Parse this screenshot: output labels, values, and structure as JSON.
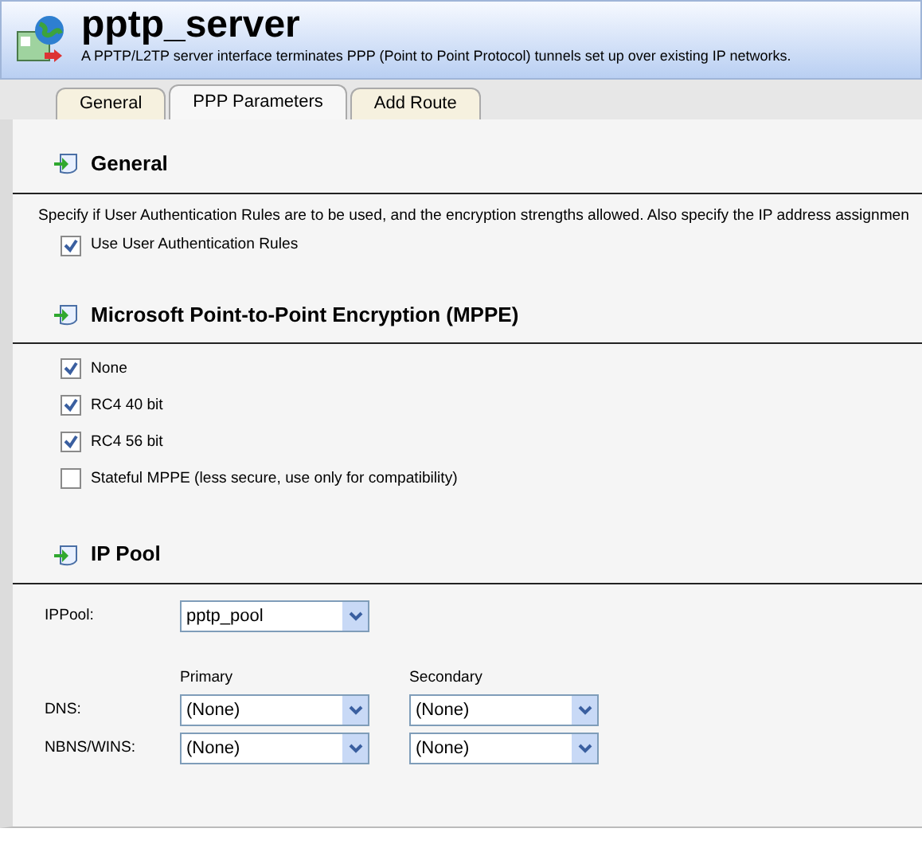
{
  "header": {
    "title": "pptp_server",
    "description": "A PPTP/L2TP server interface terminates PPP (Point to Point Protocol) tunnels set up over existing IP networks."
  },
  "tabs": [
    {
      "label": "General",
      "selected": false
    },
    {
      "label": "PPP Parameters",
      "selected": true
    },
    {
      "label": "Add Route",
      "selected": false
    }
  ],
  "general": {
    "heading": "General",
    "description": "Specify if User Authentication Rules are to be used, and the encryption strengths allowed. Also specify the IP address assignmen",
    "checkboxes": [
      {
        "label": "Use User Authentication Rules",
        "checked": true
      }
    ]
  },
  "mppe": {
    "heading": "Microsoft Point-to-Point Encryption (MPPE)",
    "checkboxes": [
      {
        "label": "None",
        "checked": true
      },
      {
        "label": "RC4 40 bit",
        "checked": true
      },
      {
        "label": "RC4 56 bit",
        "checked": true
      },
      {
        "label": "Stateful MPPE (less secure, use only for compatibility)",
        "checked": false
      }
    ]
  },
  "ip_pool": {
    "heading": "IP Pool",
    "ippool": {
      "label": "IPPool:",
      "value": "pptp_pool"
    },
    "columns": [
      "Primary",
      "Secondary"
    ],
    "rows": [
      {
        "label": "DNS:",
        "primary": "(None)",
        "secondary": "(None)"
      },
      {
        "label": "NBNS/WINS:",
        "primary": "(None)",
        "secondary": "(None)"
      }
    ]
  }
}
